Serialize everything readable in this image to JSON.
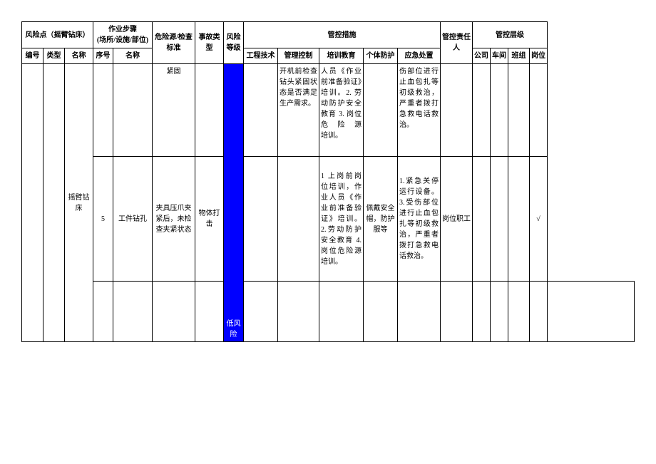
{
  "header": {
    "riskPoint": "风险点（摇臂钻床）",
    "workStep": "作业步骤\n(场所/设施/部位)",
    "hazardSource": "危险源/检查标准",
    "accidentType": "事故类型",
    "riskLevel": "风险等级",
    "controlMeasures": "管控措施",
    "controlPerson": "管控责任人",
    "controlLevel": "管控层级",
    "sub": {
      "num": "编号",
      "type": "类型",
      "name": "名称",
      "seq": "序号",
      "stepName": "名称",
      "eng": "工程技术",
      "mgmt": "管理控制",
      "train": "培训教育",
      "ppe": "个体防护",
      "emergency": "应急处置",
      "company": "公司",
      "workshop": "车间",
      "team": "班组",
      "post": "岗位"
    }
  },
  "rows": [
    {
      "hazard": "紧固",
      "mgmt": "开机前检查钻头紧固状态是否满足生产需求。",
      "train": "人员《作业前准备验证》培训。2. 劳动防护安全教育 3. 岗位危险源　　培训。",
      "emergency": "伤部位进行止血包扎等初级救治，严重者拨打急救电话救治。"
    },
    {
      "type": "摇臂钻床",
      "seq": "5",
      "stepName": "工件钻孔",
      "hazard": "夹具压爪夹紧后，未检查夹紧状态",
      "accident": "物体打击",
      "train": "1 上岗前岗位培训，作业人员《作业前准备验证》培训。2.劳动防护安全教育 4.岗位危险源培训。",
      "ppe": "佩戴安全帽，防护服等",
      "emergency": "1.紧急关停运行设备。3.受伤部位进行止血包扎等初级救治，严重者拨打急救电话救治。",
      "person": "岗位职工",
      "post": "√"
    }
  ],
  "riskLevelText": "低风险"
}
